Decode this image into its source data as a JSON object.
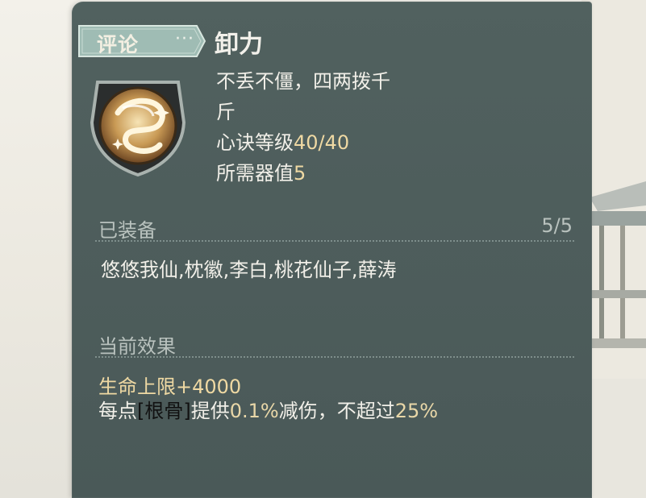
{
  "tag": {
    "label": "评论",
    "dots": "···"
  },
  "skill": {
    "title": "卸力",
    "desc_line1": "不丢不僵，四两拨千",
    "desc_line2": "斤",
    "level_label": "心诀等级",
    "level_value": "40/40",
    "cost_label": "所需器值",
    "cost_value": "5"
  },
  "equipped": {
    "heading": "已装备",
    "count": "5/5",
    "list": "悠悠我仙,枕徽,李白,桃花仙子,薛涛"
  },
  "effect": {
    "heading": "当前效果",
    "line1": "生命上限+4000",
    "line2_pre": "每点",
    "line2_bracket_open": "[",
    "line2_bracket_text": "根骨",
    "line2_bracket_close": "]",
    "line2_mid": "提供",
    "line2_val1": "0.1%",
    "line2_mid2": "减伤，不超过",
    "line2_val2": "25%"
  },
  "colors": {
    "panel": "#4e5e5c",
    "gold": "#efd9a3",
    "muted": "#b9c2be"
  },
  "icons": {
    "emblem": "swirl-emblem-icon",
    "dots": "more-dots-icon"
  }
}
